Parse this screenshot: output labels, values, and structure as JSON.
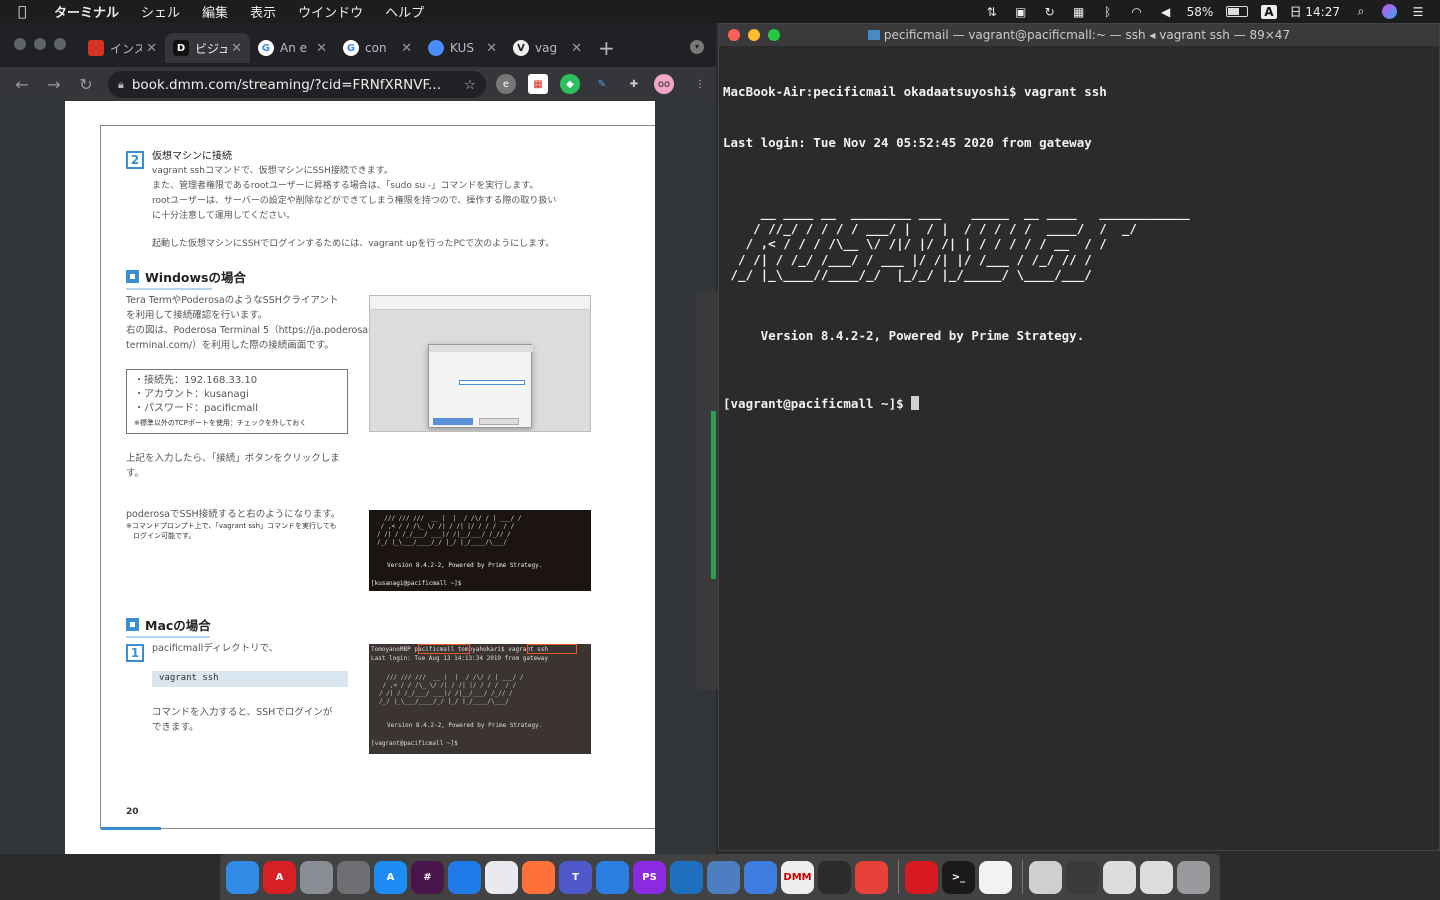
{
  "menubar": {
    "app_name": "ターミナル",
    "items": [
      "シェル",
      "編集",
      "表示",
      "ウインドウ",
      "ヘルプ"
    ],
    "battery": "58%",
    "input": "A",
    "clock": "日 14:27"
  },
  "browser": {
    "tabs": [
      {
        "title": "インス",
        "favicon": "red-arc-icon",
        "color": "#d93025"
      },
      {
        "title": "ビジュ",
        "favicon": "dmm-icon",
        "color": "#111111"
      },
      {
        "title": "An e",
        "favicon": "google-icon",
        "color": "#ffffff"
      },
      {
        "title": "con",
        "favicon": "google-icon",
        "color": "#ffffff"
      },
      {
        "title": "KUS",
        "favicon": "globe-icon",
        "color": "#4a8cf7"
      },
      {
        "title": "vag",
        "favicon": "vagrant-icon",
        "color": "#eeeeee"
      }
    ],
    "url": "book.dmm.com/streaming/?cid=FRNfXRNVF..."
  },
  "document": {
    "step2_num": "2",
    "step2_title": "仮想マシンに接続",
    "step2_body": "vagrant sshコマンドで、仮想マシンにSSH接続できます。\nまた、管理者権限であるrootユーザーに昇格する場合は、「sudo su -」コマンドを実行します。\nrootユーザーは、サーバーの設定や削除などができてしまう権限を持つので、操作する際の取り扱い\nに十分注意して運用してください。",
    "step2_login": "起動した仮想マシンにSSHでログインするためには、vagrant upを行ったPCで次のようにします。",
    "windows_heading": "Windowsの場合",
    "windows_body": "Tera TermやPoderosaのようなSSHクライアント\nを利用して接続確認を行います。\n右の図は、Poderosa Terminal 5（https://ja.poderosa-\nterminal.com/）を利用した際の接続画面です。",
    "box_lines": [
      "・接続先：192.168.33.10",
      "・アカウント：kusanagi",
      "・パスワード：pacificmall"
    ],
    "box_note": "※標準以外のTCPポートを使用：チェックを外しておく",
    "after_input": "上記を入力したら、「接続」ボタンをクリックしま\nす。",
    "poderosa_text": "poderosaでSSH接続すると右のようになります。",
    "poderosa_note": "※コマンドプロンプト上で、「vagrant ssh」コマンドを実行しても\n　ログイン可能です。",
    "thumb2_version": "Version 8.4.2-2, Powered by Prime Strategy.",
    "thumb2_prompt": "[kusanagi@pacificmall ~]$",
    "mac_heading": "Macの場合",
    "step1_num": "1",
    "step1_text": "pacificmallディレクトリで、",
    "code": "vagrant ssh",
    "step1_after": "コマンドを入力すると、SSHでログインが\nできます。",
    "thumb3_line1": "TomoyanoMBP pacificmall tomoyahokari$ vagrant ssh",
    "thumb3_line2": "Last login: Tue Aug 13 14:13:34 2019 from gateway",
    "thumb3_version": "Version 8.4.2-2, Powered by Prime Strategy.",
    "thumb3_prompt": "[vagrant@pacificmall ~]$",
    "page_number": "20"
  },
  "terminal": {
    "title": "pecificmail — vagrant@pacificmall:~ — ssh ◂ vagrant ssh — 89×47",
    "line1": "MacBook-Air:pecificmail okadaatsuyoshi$ vagrant ssh",
    "line2": "Last login: Tue Nov 24 05:52:45 2020 from gateway",
    "ascii": "     __ ____ __  ________ ___    _____  __ ____   ____________\n    / //_/ / / / / ___/ |  / |  / / / / /  ____/  /  _/\n   / ,< / / / /\\__ \\/ /|/ |/ /| | / / / / / __  / /\n  / /| / /_/ /___/ / ___ |/ /| |/ /___ / /_/ // /\n /_/ |_\\____//____/_/  |_/_/ |_/_____/ \\____/___/",
    "version": "     Version 8.4.2-2, Powered by Prime Strategy.",
    "prompt": "[vagrant@pacificmall ~]$ "
  },
  "dock": [
    {
      "name": "finder-icon",
      "label": "",
      "color": "#2f8be6"
    },
    {
      "name": "acrobat-icon",
      "label": "A",
      "color": "#d71f26"
    },
    {
      "name": "launchpad-icon",
      "label": "",
      "color": "#8a8d93"
    },
    {
      "name": "system-preferences-icon",
      "label": "",
      "color": "#6e6e73",
      "badge": "1"
    },
    {
      "name": "app-store-icon",
      "label": "A",
      "color": "#1e8cf5"
    },
    {
      "name": "slack-icon",
      "label": "#",
      "color": "#4a154b"
    },
    {
      "name": "safari-icon",
      "label": "",
      "color": "#1f7be8"
    },
    {
      "name": "chrome-icon",
      "label": "",
      "color": "#e8eaed"
    },
    {
      "name": "firefox-icon",
      "label": "",
      "color": "#ff7139"
    },
    {
      "name": "teams-icon",
      "label": "T",
      "color": "#5059c9"
    },
    {
      "name": "maps-icon",
      "label": "",
      "color": "#2a7de1"
    },
    {
      "name": "phpstorm-icon",
      "label": "PS",
      "color": "#8a2be2"
    },
    {
      "name": "vscode-icon",
      "label": "",
      "color": "#1f6fbf"
    },
    {
      "name": "virtualbox-icon",
      "label": "",
      "color": "#4d7ebf"
    },
    {
      "name": "migration-icon",
      "label": "",
      "color": "#3d7de0"
    },
    {
      "name": "dmm-books-icon",
      "label": "DMM",
      "color": "#eeeeee"
    },
    {
      "name": "kindle-icon",
      "label": "",
      "color": "#2b2b2b"
    },
    {
      "name": "timer-icon",
      "label": "",
      "color": "#e8413a"
    },
    {
      "name": "trend-micro-icon",
      "label": "",
      "color": "#d71920"
    },
    {
      "name": "terminal-icon",
      "label": ">_",
      "color": "#1a1a1a"
    },
    {
      "name": "textedit-icon",
      "label": "",
      "color": "#f2f2f2"
    },
    {
      "name": "recent-file-icon",
      "label": "",
      "color": "#cfcfcf"
    },
    {
      "name": "recent-file-icon",
      "label": "",
      "color": "#3a3a3c"
    },
    {
      "name": "recent-file-icon",
      "label": "",
      "color": "#dddddd"
    },
    {
      "name": "recent-file-icon",
      "label": "",
      "color": "#dddddd"
    },
    {
      "name": "trash-icon",
      "label": "",
      "color": "#9a9a9e"
    }
  ]
}
